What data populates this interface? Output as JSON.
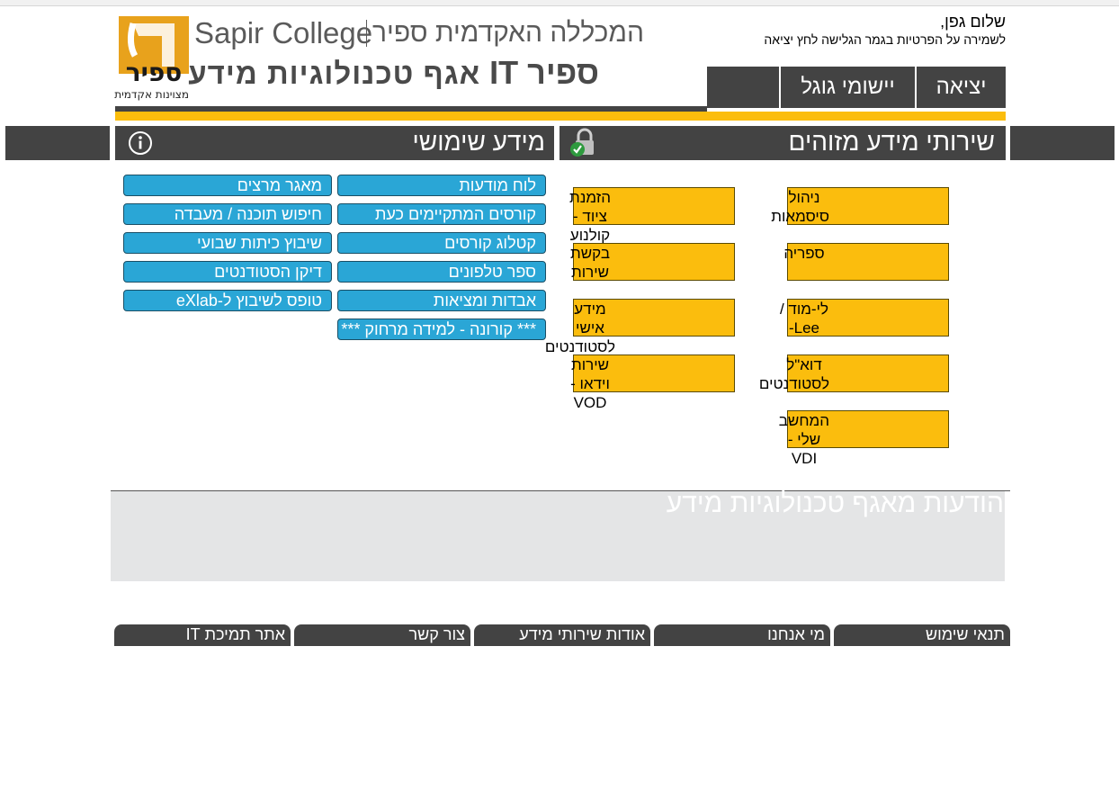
{
  "header": {
    "college_en": "Sapir College",
    "college_he": "המכללה האקדמית ספיר",
    "it_title_main": "ספיר IT",
    "it_title_sub": "אגף טכנולוגיות מידע",
    "logo": {
      "letter": "ס",
      "name": "ספיר",
      "tagline": "מצוינות אקדמית",
      "color_orange": "#e8a21c"
    }
  },
  "user": {
    "greeting": "שלום גפן,",
    "privacy_note": "לשמירה על הפרטיות בגמר הגלישה לחץ יציאה"
  },
  "top_buttons": {
    "exit": "יציאה",
    "google_apps": "יישומי גוגל",
    "blank": ""
  },
  "sections": {
    "info_use": "מידע שימושי",
    "identified": "שירותי מידע מזוהים"
  },
  "useful_links": {
    "col_right": [
      "לוח מודעות",
      "קורסים המתקיימים כעת",
      "קטלוג קורסים",
      "ספר טלפונים",
      "אבדות ומציאות",
      "*** קורונה - למידה מרחוק ***"
    ],
    "col_left": [
      "מאגר מרצים",
      "חיפוש תוכנה / מעבדה",
      "שיבוץ כיתות שבועי",
      "דיקן הסטודנטים",
      "טופס לשיבוץ ל-eXlab"
    ]
  },
  "identified_services": {
    "right": [
      "ניהול סיסמאות",
      "ספריה",
      "לי-מוד / Lee-",
      "דוא\"ל לסטודנטים",
      "המחשב שלי - VDI"
    ],
    "left": [
      "הזמנת ציוד - קולנוע",
      "בקשת שירות",
      "מידע אישי לסטודנטים",
      "שירות וידאו - VOD"
    ]
  },
  "announcements": {
    "title": "הודעות מאגף טכנולוגיות מידע"
  },
  "footer": {
    "tabs": [
      "תנאי שימוש",
      "מי אנחנו",
      "אודות שירותי מידע",
      "צור קשר",
      "אתר תמיכת IT"
    ]
  },
  "colors": {
    "dark_bar": "#434343",
    "accent_yellow": "#fbbd0d",
    "link_blue": "#2aa6d6",
    "panel_gray": "#e4e5e6"
  }
}
